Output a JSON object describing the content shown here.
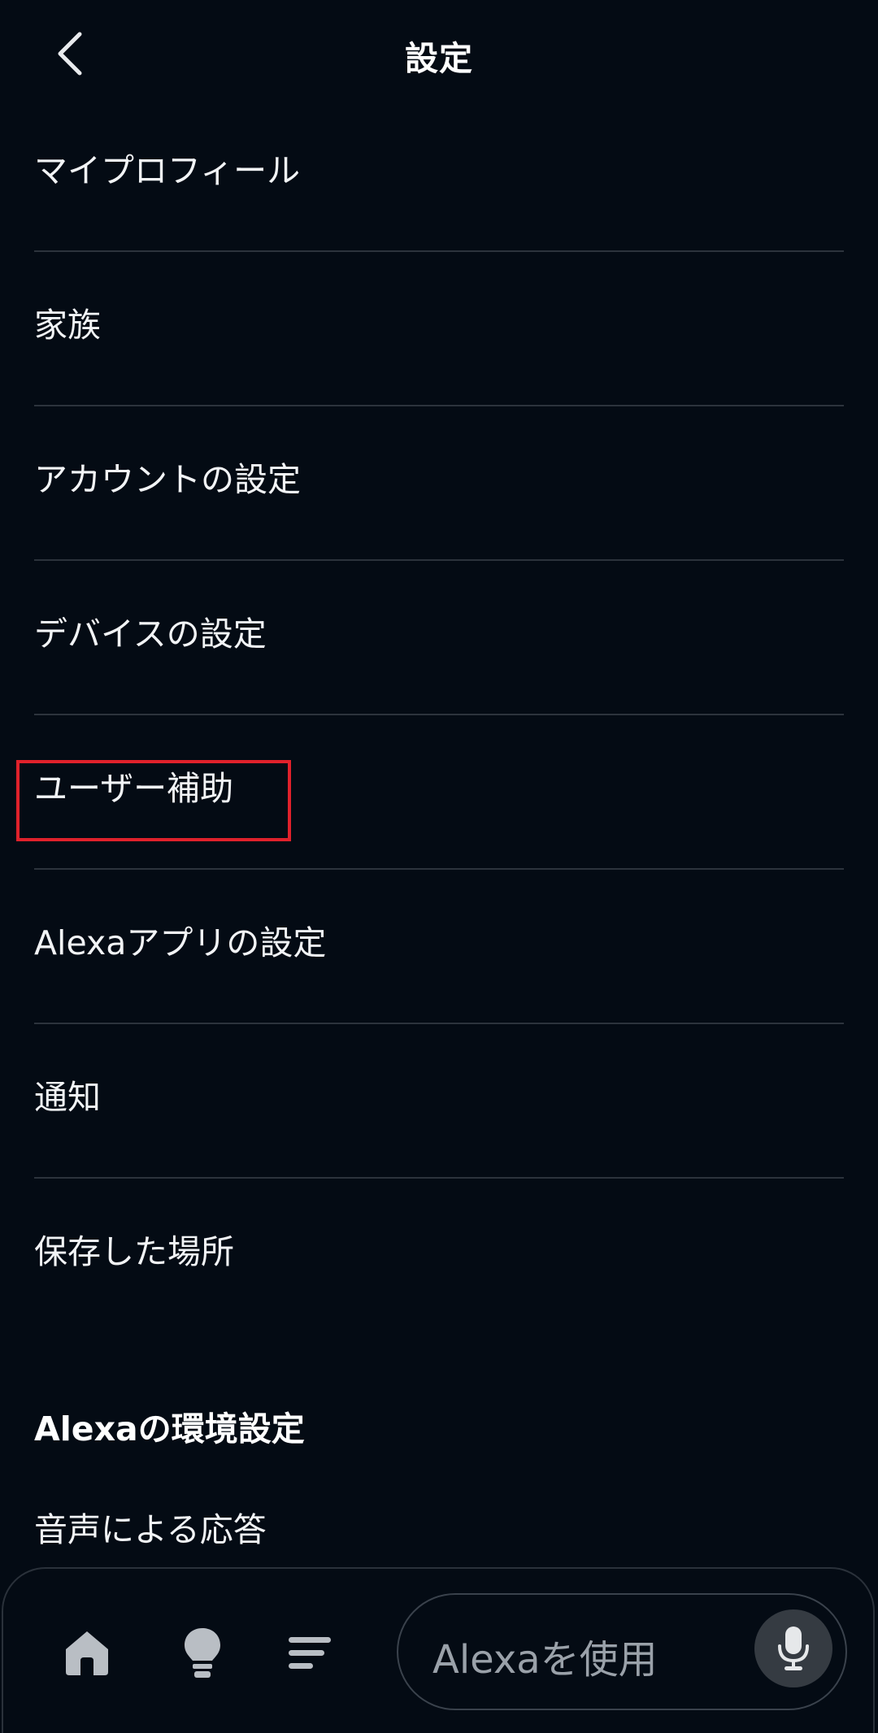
{
  "header": {
    "title": "設定"
  },
  "menu": {
    "items": [
      {
        "label": "マイプロフィール"
      },
      {
        "label": "家族"
      },
      {
        "label": "アカウントの設定"
      },
      {
        "label": "デバイスの設定"
      },
      {
        "label": "ユーザー補助"
      },
      {
        "label": "Alexaアプリの設定"
      },
      {
        "label": "通知"
      },
      {
        "label": "保存した場所"
      }
    ]
  },
  "alexa_preferences": {
    "heading": "Alexaの環境設定",
    "items": [
      {
        "label": "音声による応答"
      }
    ]
  },
  "bottom_nav": {
    "icons": [
      "home-icon",
      "lightbulb-icon",
      "list-icon"
    ],
    "input_placeholder": "Alexaを使用",
    "mic_icon": "microphone-icon"
  },
  "colors": {
    "background": "#040b14",
    "highlight": "#e0212b",
    "divider": "#2c333c"
  }
}
